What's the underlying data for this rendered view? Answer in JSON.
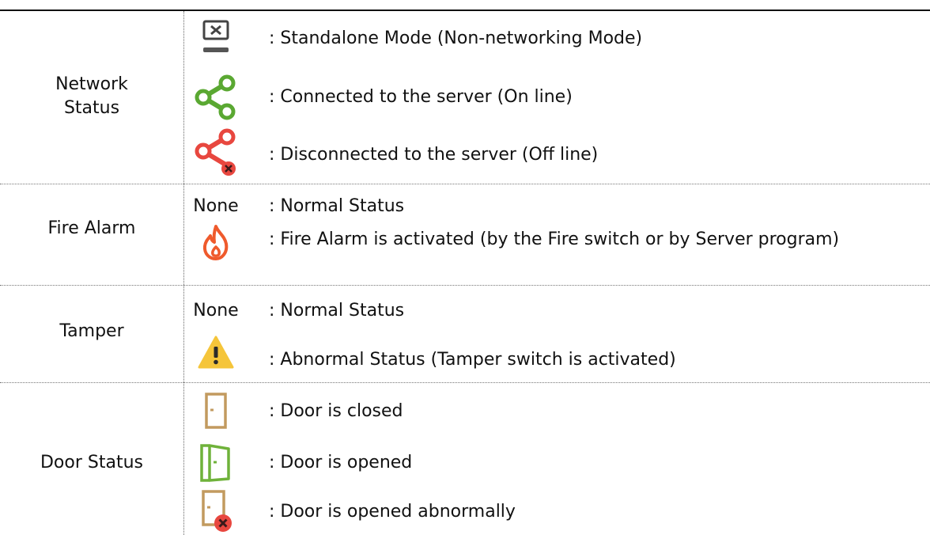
{
  "rows": {
    "network": {
      "label_line1": "Network",
      "label_line2": "Status",
      "items": [
        {
          "icon": "standalone-monitor-icon",
          "text": ": Standalone Mode (Non-networking Mode)"
        },
        {
          "icon": "share-network-green-icon",
          "text": ": Connected to the server (On line)"
        },
        {
          "icon": "share-network-red-x-icon",
          "text": ": Disconnected to the server (Off line)"
        }
      ]
    },
    "fire": {
      "label": "Fire Alarm",
      "none_label": "None",
      "items": [
        {
          "text": ": Normal Status"
        },
        {
          "icon": "fire-icon",
          "text": ": Fire Alarm is activated (by the Fire switch or by Server program)"
        }
      ]
    },
    "tamper": {
      "label": "Tamper",
      "none_label": "None",
      "items": [
        {
          "text": ": Normal Status"
        },
        {
          "icon": "warning-triangle-icon",
          "text": ": Abnormal Status (Tamper switch is activated)"
        }
      ]
    },
    "door": {
      "label": "Door Status",
      "items": [
        {
          "icon": "door-closed-icon",
          "text": ": Door is closed"
        },
        {
          "icon": "door-opened-icon",
          "text": ": Door is opened"
        },
        {
          "icon": "door-abnormal-icon",
          "text": ": Door is opened abnormally"
        }
      ]
    }
  },
  "colors": {
    "green": "#5aa832",
    "red": "#e8473f",
    "fire": "#ef5a2c",
    "warning": "#f5c53a",
    "door": "#c29a5f",
    "door_green": "#6fb23a",
    "monitor": "#444444"
  }
}
